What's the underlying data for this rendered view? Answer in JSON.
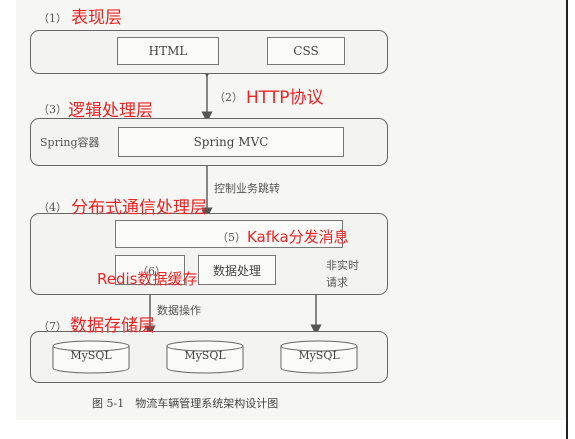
{
  "layers": {
    "presentation": {
      "num": "（1）",
      "title": "表现层",
      "html": "HTML",
      "css": "CSS"
    },
    "http": {
      "num": "（2）",
      "title": "HTTP协议"
    },
    "logic": {
      "num": "（3）",
      "title": "逻辑处理层",
      "container": "Spring容器",
      "mvc": "Spring MVC"
    },
    "control": {
      "label": "控制业务跳转"
    },
    "distributed": {
      "num": "（4）",
      "title": "分布式通信处理层"
    },
    "kafka": {
      "num": "（5）",
      "title": "Kafka分发消息"
    },
    "redis": {
      "num": "（6）",
      "title": "Redis数据缓存",
      "processing": "数据处理"
    },
    "nonrealtime": {
      "line1": "非实时",
      "line2": "请求"
    },
    "dataop": {
      "label": "数据操作"
    },
    "storage": {
      "num": "（7）",
      "title": "数据存储层",
      "db": [
        "MySQL",
        "MySQL",
        "MySQL"
      ]
    }
  },
  "caption": "图 5-1　物流车辆管理系统架构设计图"
}
